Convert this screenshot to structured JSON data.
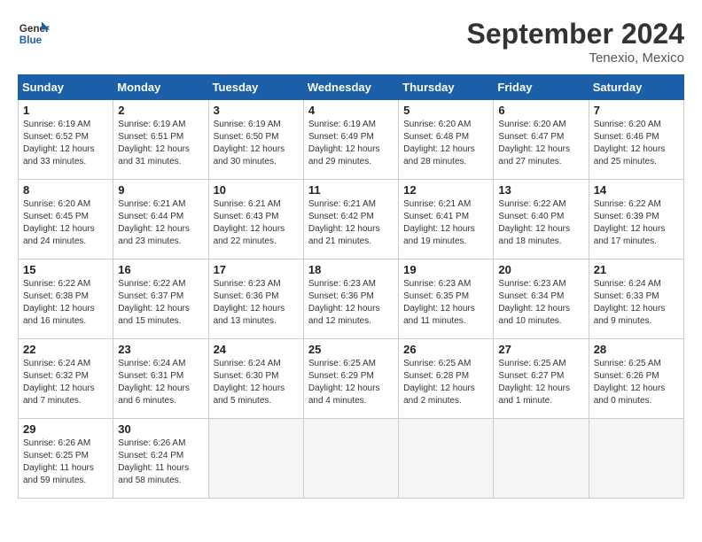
{
  "header": {
    "logo_line1": "General",
    "logo_line2": "Blue",
    "month": "September 2024",
    "location": "Tenexio, Mexico"
  },
  "days_of_week": [
    "Sunday",
    "Monday",
    "Tuesday",
    "Wednesday",
    "Thursday",
    "Friday",
    "Saturday"
  ],
  "weeks": [
    [
      {
        "num": "1",
        "lines": [
          "Sunrise: 6:19 AM",
          "Sunset: 6:52 PM",
          "Daylight: 12 hours",
          "and 33 minutes."
        ]
      },
      {
        "num": "2",
        "lines": [
          "Sunrise: 6:19 AM",
          "Sunset: 6:51 PM",
          "Daylight: 12 hours",
          "and 31 minutes."
        ]
      },
      {
        "num": "3",
        "lines": [
          "Sunrise: 6:19 AM",
          "Sunset: 6:50 PM",
          "Daylight: 12 hours",
          "and 30 minutes."
        ]
      },
      {
        "num": "4",
        "lines": [
          "Sunrise: 6:19 AM",
          "Sunset: 6:49 PM",
          "Daylight: 12 hours",
          "and 29 minutes."
        ]
      },
      {
        "num": "5",
        "lines": [
          "Sunrise: 6:20 AM",
          "Sunset: 6:48 PM",
          "Daylight: 12 hours",
          "and 28 minutes."
        ]
      },
      {
        "num": "6",
        "lines": [
          "Sunrise: 6:20 AM",
          "Sunset: 6:47 PM",
          "Daylight: 12 hours",
          "and 27 minutes."
        ]
      },
      {
        "num": "7",
        "lines": [
          "Sunrise: 6:20 AM",
          "Sunset: 6:46 PM",
          "Daylight: 12 hours",
          "and 25 minutes."
        ]
      }
    ],
    [
      {
        "num": "8",
        "lines": [
          "Sunrise: 6:20 AM",
          "Sunset: 6:45 PM",
          "Daylight: 12 hours",
          "and 24 minutes."
        ]
      },
      {
        "num": "9",
        "lines": [
          "Sunrise: 6:21 AM",
          "Sunset: 6:44 PM",
          "Daylight: 12 hours",
          "and 23 minutes."
        ]
      },
      {
        "num": "10",
        "lines": [
          "Sunrise: 6:21 AM",
          "Sunset: 6:43 PM",
          "Daylight: 12 hours",
          "and 22 minutes."
        ]
      },
      {
        "num": "11",
        "lines": [
          "Sunrise: 6:21 AM",
          "Sunset: 6:42 PM",
          "Daylight: 12 hours",
          "and 21 minutes."
        ]
      },
      {
        "num": "12",
        "lines": [
          "Sunrise: 6:21 AM",
          "Sunset: 6:41 PM",
          "Daylight: 12 hours",
          "and 19 minutes."
        ]
      },
      {
        "num": "13",
        "lines": [
          "Sunrise: 6:22 AM",
          "Sunset: 6:40 PM",
          "Daylight: 12 hours",
          "and 18 minutes."
        ]
      },
      {
        "num": "14",
        "lines": [
          "Sunrise: 6:22 AM",
          "Sunset: 6:39 PM",
          "Daylight: 12 hours",
          "and 17 minutes."
        ]
      }
    ],
    [
      {
        "num": "15",
        "lines": [
          "Sunrise: 6:22 AM",
          "Sunset: 6:38 PM",
          "Daylight: 12 hours",
          "and 16 minutes."
        ]
      },
      {
        "num": "16",
        "lines": [
          "Sunrise: 6:22 AM",
          "Sunset: 6:37 PM",
          "Daylight: 12 hours",
          "and 15 minutes."
        ]
      },
      {
        "num": "17",
        "lines": [
          "Sunrise: 6:23 AM",
          "Sunset: 6:36 PM",
          "Daylight: 12 hours",
          "and 13 minutes."
        ]
      },
      {
        "num": "18",
        "lines": [
          "Sunrise: 6:23 AM",
          "Sunset: 6:36 PM",
          "Daylight: 12 hours",
          "and 12 minutes."
        ]
      },
      {
        "num": "19",
        "lines": [
          "Sunrise: 6:23 AM",
          "Sunset: 6:35 PM",
          "Daylight: 12 hours",
          "and 11 minutes."
        ]
      },
      {
        "num": "20",
        "lines": [
          "Sunrise: 6:23 AM",
          "Sunset: 6:34 PM",
          "Daylight: 12 hours",
          "and 10 minutes."
        ]
      },
      {
        "num": "21",
        "lines": [
          "Sunrise: 6:24 AM",
          "Sunset: 6:33 PM",
          "Daylight: 12 hours",
          "and 9 minutes."
        ]
      }
    ],
    [
      {
        "num": "22",
        "lines": [
          "Sunrise: 6:24 AM",
          "Sunset: 6:32 PM",
          "Daylight: 12 hours",
          "and 7 minutes."
        ]
      },
      {
        "num": "23",
        "lines": [
          "Sunrise: 6:24 AM",
          "Sunset: 6:31 PM",
          "Daylight: 12 hours",
          "and 6 minutes."
        ]
      },
      {
        "num": "24",
        "lines": [
          "Sunrise: 6:24 AM",
          "Sunset: 6:30 PM",
          "Daylight: 12 hours",
          "and 5 minutes."
        ]
      },
      {
        "num": "25",
        "lines": [
          "Sunrise: 6:25 AM",
          "Sunset: 6:29 PM",
          "Daylight: 12 hours",
          "and 4 minutes."
        ]
      },
      {
        "num": "26",
        "lines": [
          "Sunrise: 6:25 AM",
          "Sunset: 6:28 PM",
          "Daylight: 12 hours",
          "and 2 minutes."
        ]
      },
      {
        "num": "27",
        "lines": [
          "Sunrise: 6:25 AM",
          "Sunset: 6:27 PM",
          "Daylight: 12 hours",
          "and 1 minute."
        ]
      },
      {
        "num": "28",
        "lines": [
          "Sunrise: 6:25 AM",
          "Sunset: 6:26 PM",
          "Daylight: 12 hours",
          "and 0 minutes."
        ]
      }
    ],
    [
      {
        "num": "29",
        "lines": [
          "Sunrise: 6:26 AM",
          "Sunset: 6:25 PM",
          "Daylight: 11 hours",
          "and 59 minutes."
        ]
      },
      {
        "num": "30",
        "lines": [
          "Sunrise: 6:26 AM",
          "Sunset: 6:24 PM",
          "Daylight: 11 hours",
          "and 58 minutes."
        ]
      },
      {
        "num": "",
        "lines": []
      },
      {
        "num": "",
        "lines": []
      },
      {
        "num": "",
        "lines": []
      },
      {
        "num": "",
        "lines": []
      },
      {
        "num": "",
        "lines": []
      }
    ]
  ]
}
